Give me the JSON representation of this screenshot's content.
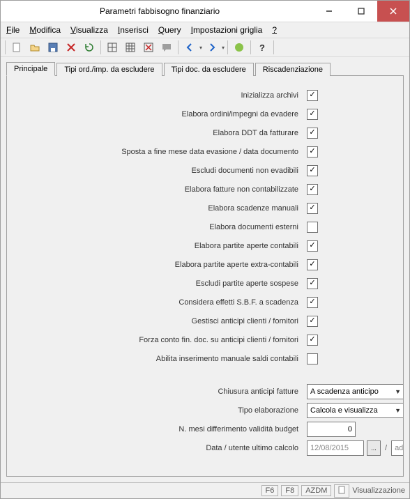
{
  "window": {
    "title": "Parametri fabbisogno finanziario"
  },
  "menu": {
    "file": "File",
    "modifica": "Modifica",
    "visualizza": "Visualizza",
    "inserisci": "Inserisci",
    "query": "Query",
    "impostazioni": "Impostazioni griglia",
    "help": "?"
  },
  "tabs": {
    "principale": "Principale",
    "tipi_ord": "Tipi ord./imp. da escludere",
    "tipi_doc": "Tipi doc. da escludere",
    "riscad": "Riscadenziazione"
  },
  "labels": {
    "inizializza": "Inizializza archivi",
    "elabora_ordini": "Elabora ordini/impegni da evadere",
    "elabora_ddt": "Elabora DDT da fatturare",
    "sposta_fine": "Sposta a fine mese data evasione / data documento",
    "escludi_doc": "Escludi documenti non evadibili",
    "elabora_fatt": "Elabora fatture non contabilizzate",
    "elabora_scad": "Elabora scadenze manuali",
    "elabora_doc_est": "Elabora documenti esterni",
    "elabora_part_cont": "Elabora partite aperte contabili",
    "elabora_part_extra": "Elabora partite aperte extra-contabili",
    "escludi_part_sosp": "Escludi partite aperte sospese",
    "considera_sbf": "Considera effetti S.B.F. a scadenza",
    "gestisci_anticipi": "Gestisci anticipi clienti / fornitori",
    "forza_conto": "Forza conto fin. doc. su anticipi clienti / fornitori",
    "abilita_ins": "Abilita inserimento manuale saldi contabili",
    "chiusura_anticipi": "Chiusura anticipi fatture",
    "tipo_elab": "Tipo elaborazione",
    "n_mesi": "N. mesi differimento validità budget",
    "data_utente": "Data / utente ultimo calcolo"
  },
  "values": {
    "chiusura_anticipi": "A scadenza anticipo",
    "tipo_elab": "Calcola e visualizza",
    "n_mesi": "0",
    "data": "12/08/2015",
    "pick": "...",
    "utente": "adme"
  },
  "status": {
    "f6": "F6",
    "f8": "F8",
    "azdm": "AZDM",
    "mode": "Visualizzazione"
  }
}
